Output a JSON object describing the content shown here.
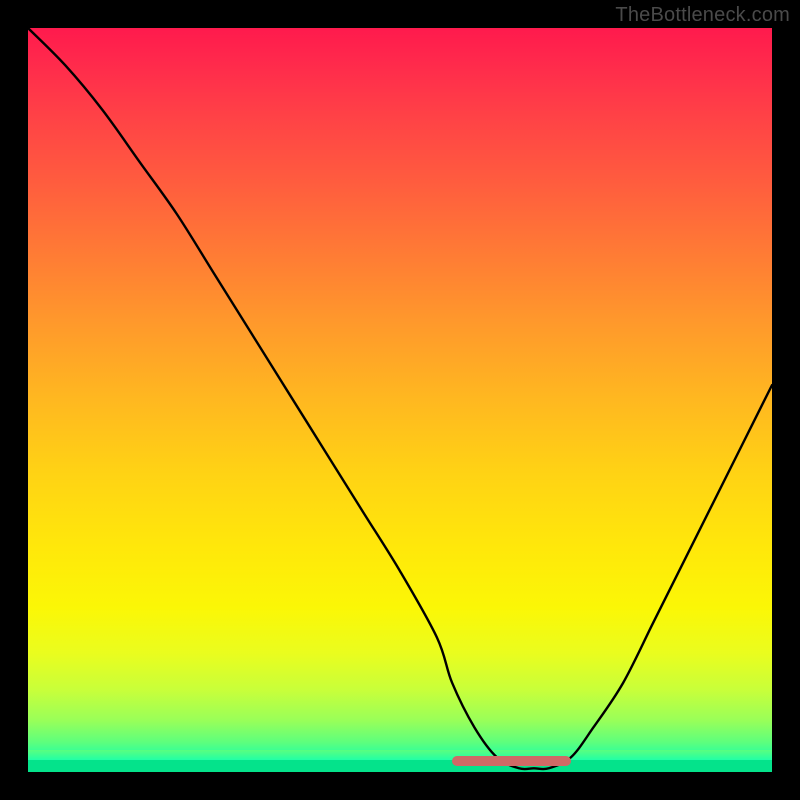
{
  "watermark": "TheBottleneck.com",
  "colors": {
    "curve": "#000000",
    "marker": "#cf6a66",
    "frame": "#000000"
  },
  "chart_data": {
    "type": "line",
    "title": "",
    "xlabel": "",
    "ylabel": "",
    "xlim": [
      0,
      100
    ],
    "ylim": [
      0,
      100
    ],
    "grid": false,
    "legend": false,
    "series": [
      {
        "name": "bottleneck-curve",
        "x": [
          0,
          5,
          10,
          15,
          20,
          25,
          30,
          35,
          40,
          45,
          50,
          55,
          57,
          60,
          63,
          66,
          68,
          70,
          73,
          76,
          80,
          84,
          88,
          92,
          96,
          100
        ],
        "y": [
          100,
          95,
          89,
          82,
          75,
          67,
          59,
          51,
          43,
          35,
          27,
          18,
          12,
          6,
          2,
          0.5,
          0.5,
          0.5,
          2,
          6,
          12,
          20,
          28,
          36,
          44,
          52
        ]
      }
    ],
    "valley_marker": {
      "x_start": 57,
      "x_end": 73,
      "y": 0.5
    },
    "background_gradient": {
      "stops": [
        {
          "pos": 0,
          "color": "#ff1a4d"
        },
        {
          "pos": 50,
          "color": "#ffb820"
        },
        {
          "pos": 78,
          "color": "#fbf706"
        },
        {
          "pos": 96,
          "color": "#5dff7d"
        },
        {
          "pos": 100,
          "color": "#00f7c4"
        }
      ]
    }
  }
}
